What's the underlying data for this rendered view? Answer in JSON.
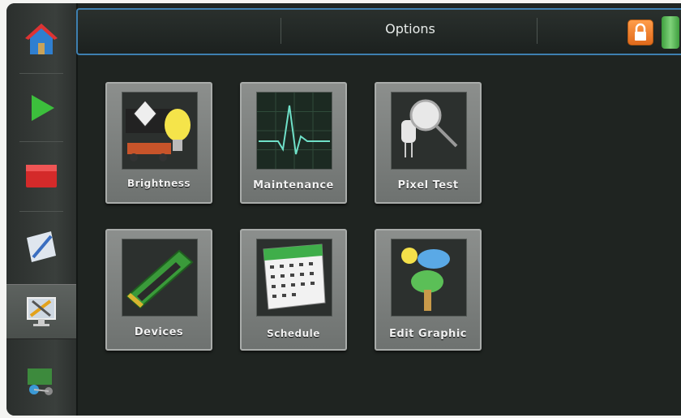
{
  "header": {
    "title": "Options"
  },
  "sidebar": {
    "items": [
      {
        "name": "home"
      },
      {
        "name": "play"
      },
      {
        "name": "stop"
      },
      {
        "name": "edit"
      },
      {
        "name": "options",
        "active": true
      },
      {
        "name": "network"
      }
    ]
  },
  "tiles": [
    {
      "label": "Brightness"
    },
    {
      "label": "Maintenance"
    },
    {
      "label": "Pixel Test"
    },
    {
      "label": "Devices"
    },
    {
      "label": "Schedule"
    },
    {
      "label": "Edit Graphic"
    }
  ],
  "colors": {
    "accent": "#3e7fb0",
    "lock": "#f07a28",
    "battery": "#5bbf57"
  }
}
